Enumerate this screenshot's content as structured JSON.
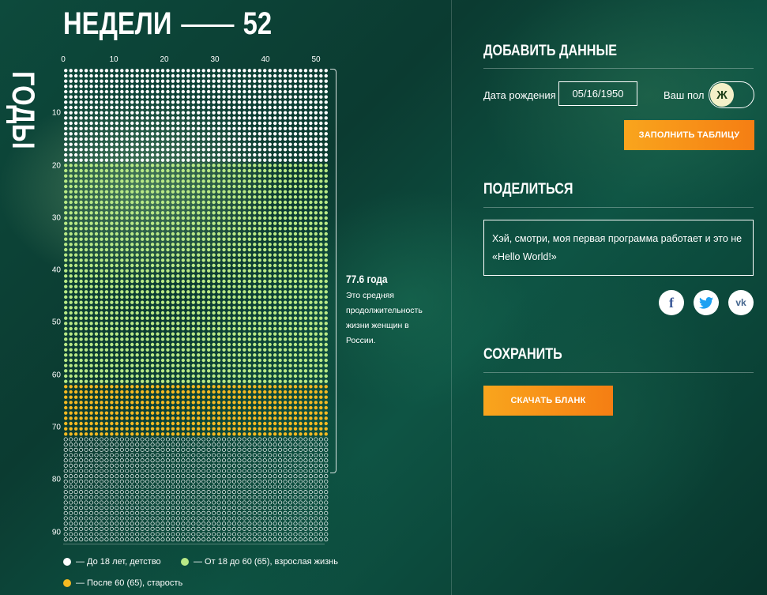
{
  "header": {
    "weeks_label": "НЕДЕЛИ",
    "weeks_count": "52",
    "years_label": "ГОДЫ"
  },
  "axes": {
    "x_ticks": [
      "0",
      "10",
      "20",
      "30",
      "40",
      "50"
    ],
    "y_ticks": [
      "10",
      "20",
      "30",
      "40",
      "50",
      "60",
      "70",
      "80",
      "90"
    ]
  },
  "chart_data": {
    "type": "heatmap",
    "xlabel": "НЕДЕЛИ",
    "ylabel": "ГОДЫ",
    "weeks_per_year": 52,
    "years": 90,
    "segments": [
      {
        "name": "До 18 лет, детство",
        "from_year": 0,
        "to_year": 18,
        "color": "#ffffff"
      },
      {
        "name": "От 18 до 60 (65), взрослая жизнь",
        "from_year": 18,
        "to_year": 60,
        "color": "#b8e986"
      },
      {
        "name": "После 60 (65), старость",
        "from_year": 60,
        "to_year": 70,
        "color": "#f5b921"
      },
      {
        "name": "",
        "from_year": 70,
        "to_year": 90,
        "color": "#ffffff",
        "style": "outline"
      }
    ],
    "life_expectancy_years": 77.6
  },
  "note": {
    "value": "77.6 года",
    "text": "Это средняя продолжительность жизни женщин в России."
  },
  "legend": {
    "childhood": "— До 18 лет, детство",
    "adult": "— От 18 до 60 (65), взрослая жизнь",
    "old": "— После 60 (65), старость"
  },
  "colors": {
    "childhood": "#ffffff",
    "adult": "#b8e986",
    "old": "#f5b921",
    "accent": "#f7941d"
  },
  "form": {
    "title": "ДОБАВИТЬ ДАННЫЕ",
    "birth_label": "Дата рождения",
    "birth_value": "05/16/1950",
    "gender_label": "Ваш пол",
    "gender_value": "Ж",
    "fill_button": "ЗАПОЛНИТЬ ТАБЛИЦУ"
  },
  "share": {
    "title": "ПОДЕЛИТЬСЯ",
    "message": "Хэй, смотри, моя первая программа работает и это не «Hello World!»",
    "icons": [
      "facebook-icon",
      "twitter-icon",
      "vk-icon"
    ]
  },
  "save": {
    "title": "СОХРАНИТЬ",
    "download_button": "СКАЧАТЬ БЛАНК"
  }
}
